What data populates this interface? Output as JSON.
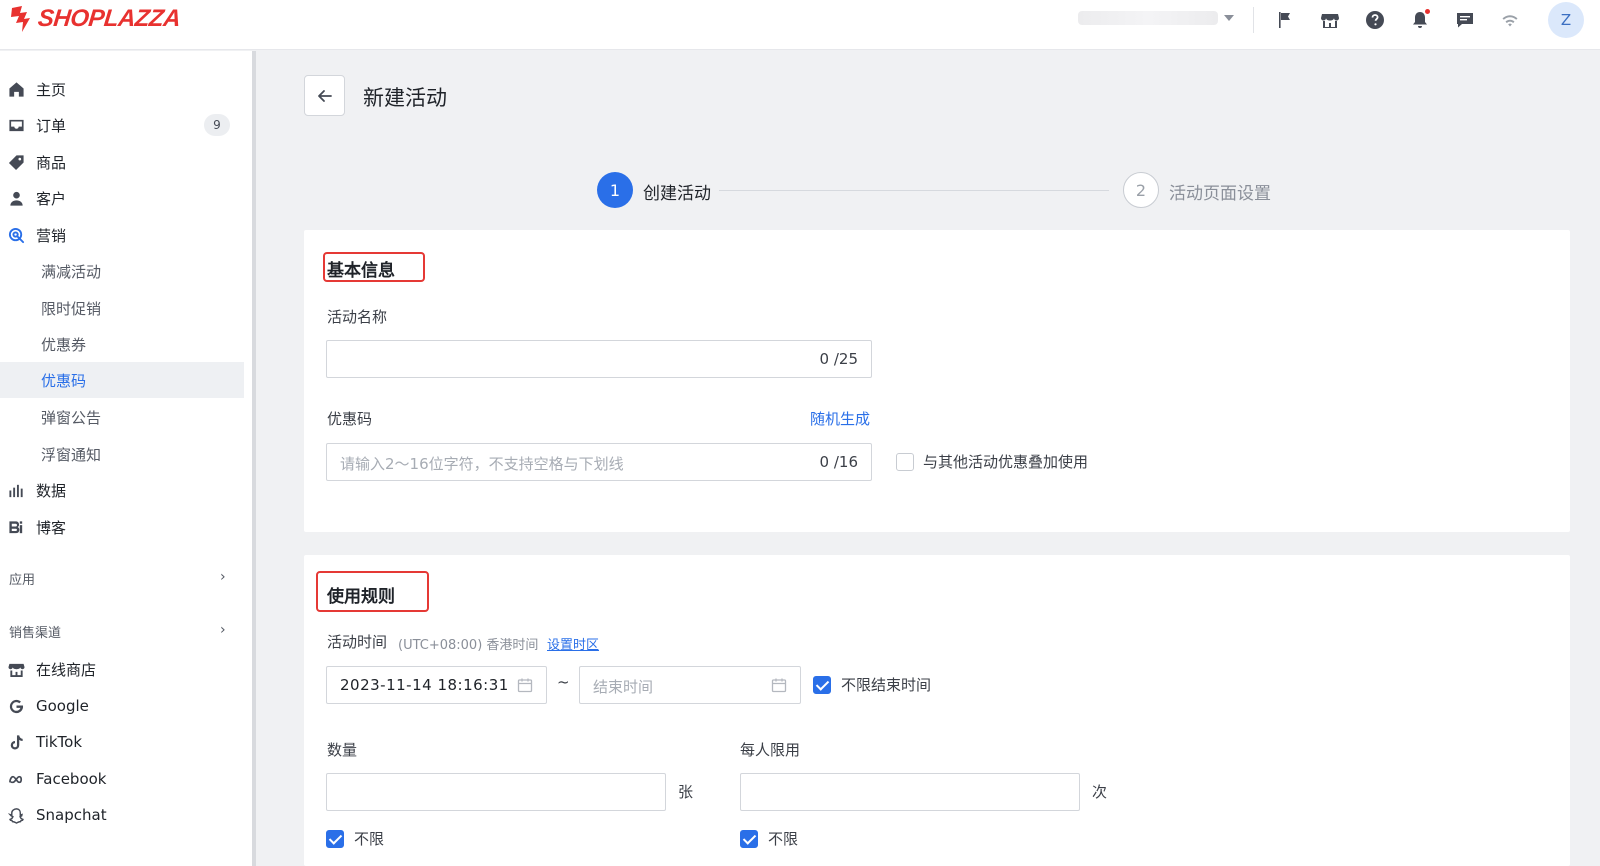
{
  "brand": {
    "name": "SHOPLAZZA",
    "color": "#e8312f"
  },
  "topbar": {
    "icons": [
      "flag-icon",
      "store-icon",
      "help-icon",
      "bell-icon",
      "message-icon",
      "wifi-icon"
    ],
    "avatar_initial": "Z"
  },
  "sidebar": {
    "items": [
      {
        "label": "主页",
        "icon": "home-icon"
      },
      {
        "label": "订单",
        "icon": "inbox-icon",
        "badge": "9"
      },
      {
        "label": "商品",
        "icon": "tag-icon"
      },
      {
        "label": "客户",
        "icon": "user-icon"
      },
      {
        "label": "营销",
        "icon": "marketing-icon"
      }
    ],
    "marketing_sub": [
      "满减活动",
      "限时促销",
      "优惠券",
      "优惠码",
      "弹窗公告",
      "浮窗通知"
    ],
    "active_sub": "优惠码",
    "items2": [
      {
        "label": "数据",
        "icon": "bar-chart-icon"
      },
      {
        "label": "博客",
        "icon": "blog-icon"
      }
    ],
    "apps_label": "应用",
    "channels_label": "销售渠道",
    "channels": [
      {
        "label": "在线商店",
        "icon": "store-icon"
      },
      {
        "label": "Google",
        "icon": "google-icon"
      },
      {
        "label": "TikTok",
        "icon": "tiktok-icon"
      },
      {
        "label": "Facebook",
        "icon": "meta-icon"
      },
      {
        "label": "Snapchat",
        "icon": "snapchat-icon"
      }
    ]
  },
  "page": {
    "title": "新建活动",
    "steps": [
      {
        "num": "1",
        "label": "创建活动",
        "state": "current"
      },
      {
        "num": "2",
        "label": "活动页面设置",
        "state": "pending"
      }
    ]
  },
  "basic_info": {
    "title": "基本信息",
    "name_label": "活动名称",
    "name_value": "",
    "name_count": "0 /25",
    "code_label": "优惠码",
    "random_link": "随机生成",
    "code_placeholder": "请输入2～16位字符，不支持空格与下划线",
    "code_count": "0 /16",
    "stack_label": "与其他活动优惠叠加使用",
    "stack_checked": false
  },
  "rules": {
    "title": "使用规则",
    "time_label": "活动时间",
    "tz_text": "(UTC+08:00) 香港时间",
    "tz_link": "设置时区",
    "start_value": "2023-11-14 18:16:31",
    "range_sep": "~",
    "end_placeholder": "结束时间",
    "no_end_label": "不限结束时间",
    "no_end_checked": true,
    "qty_label": "数量",
    "qty_unit": "张",
    "qty_unlimited": "不限",
    "per_label": "每人限用",
    "per_unit": "次",
    "per_unlimited": "不限"
  },
  "colors": {
    "accent": "#2a6fe8",
    "highlight": "#e53935"
  }
}
